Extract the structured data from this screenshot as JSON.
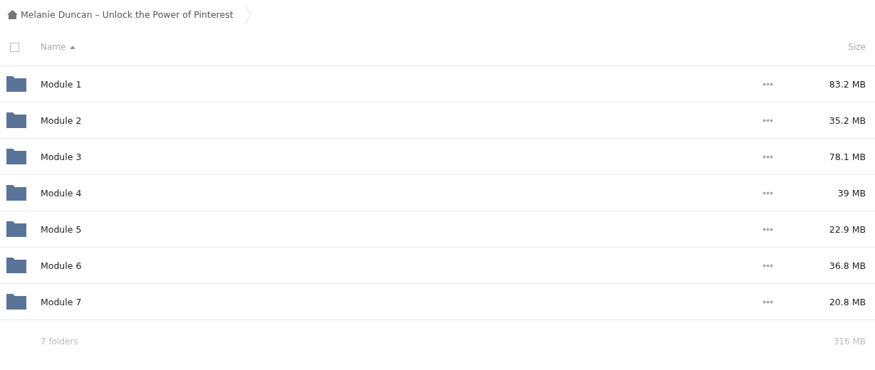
{
  "breadcrumb": {
    "title": "Melanie Duncan – Unlock the Power of Pinterest"
  },
  "table": {
    "select_all": {
      "checked": false
    },
    "columns": [
      {
        "label": "Name",
        "sorted": true
      },
      {
        "label": "Size",
        "sorted": false
      }
    ],
    "rows": [
      {
        "name": "Module 1",
        "size": "83.2 MB"
      },
      {
        "name": "Module 2",
        "size": "35.2 MB"
      },
      {
        "name": "Module 3",
        "size": "78.1 MB"
      },
      {
        "name": "Module 4",
        "size": "39 MB"
      },
      {
        "name": "Module 5",
        "size": "22.9 MB"
      },
      {
        "name": "Module 6",
        "size": "36.8 MB"
      },
      {
        "name": "Module 7",
        "size": "20.8 MB"
      }
    ]
  },
  "summary": {
    "count": "7 folders",
    "total": "316 MB"
  }
}
